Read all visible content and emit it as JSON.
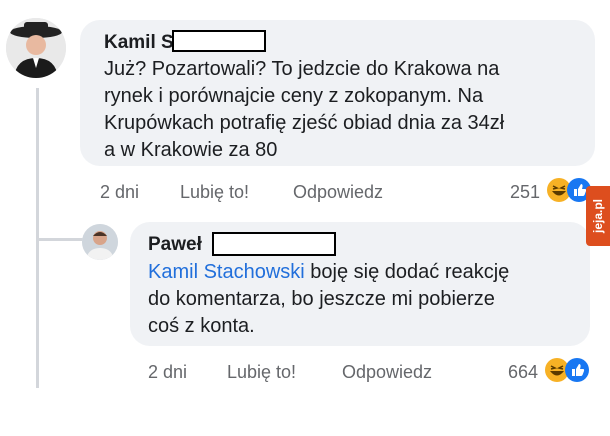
{
  "comments": [
    {
      "author": "Kamil S",
      "text": "Już? Pozartowali? To jedzcie do Krakowa na\nrynek i porównajcie ceny z zokopanym. Na\nKrupówkach potrafię zjeść obiad dnia za 34zł\na w Krakowie za 80",
      "time": "2 dni",
      "like_label": "Lubię to!",
      "reply_label": "Odpowiedz",
      "reaction_count": "251",
      "reactions": [
        "haha-icon",
        "like-icon"
      ]
    },
    {
      "author": "Paweł",
      "mention": "Kamil Stachowski",
      "text": " boję się dodać reakcję\ndo komentarza, bo jeszcze mi pobierze\ncoś z konta.",
      "time": "2 dni",
      "like_label": "Lubię to!",
      "reply_label": "Odpowiedz",
      "reaction_count": "664",
      "reactions": [
        "haha-icon",
        "like-icon"
      ]
    }
  ],
  "watermark": "jeja.pl",
  "colors": {
    "bubble": "#f0f2f5",
    "mention": "#216fdb",
    "meta": "#65676b",
    "watermark": "#dd4e1e"
  }
}
